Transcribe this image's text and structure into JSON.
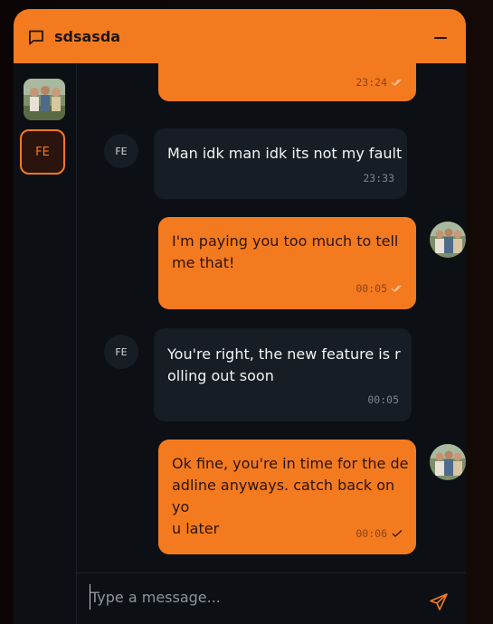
{
  "chat": {
    "title": "sdsasda",
    "minimize_icon": "minus-icon",
    "header_icon": "chat-bubble-icon"
  },
  "sidebar": {
    "items": [
      {
        "type": "photo",
        "label": ""
      },
      {
        "type": "initials",
        "label": "FE",
        "active": true
      }
    ]
  },
  "messages": [
    {
      "from": "me",
      "text": "",
      "time": "23:24",
      "status": "read"
    },
    {
      "from": "FE",
      "text": "Man idk man idk its not my fault",
      "time": "23:33"
    },
    {
      "from": "me",
      "text": "I'm paying you too much to tell\nme that!",
      "time": "00:05",
      "status": "read"
    },
    {
      "from": "FE",
      "text": "You're right, the new feature is r\nolling out soon",
      "time": "00:05"
    },
    {
      "from": "me",
      "text": "Ok fine, you're in time for the de\nadline anyways. catch back on yo\nu later",
      "time": "00:06",
      "status": "sent"
    }
  ],
  "avatar_initials": "FE",
  "composer": {
    "placeholder": "Type a message...",
    "value": ""
  },
  "colors": {
    "accent": "#f47a20",
    "panel": "#0c1014",
    "bubble_theirs": "#171d24"
  }
}
